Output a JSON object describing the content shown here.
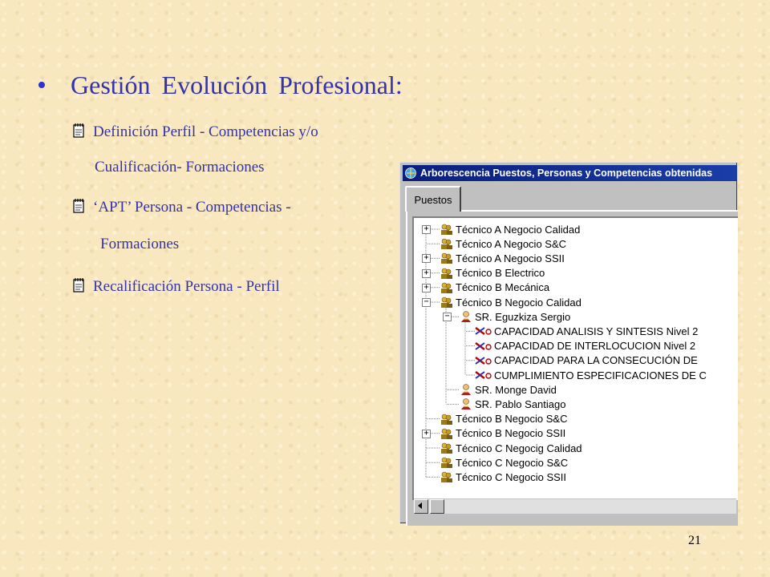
{
  "slide": {
    "title": "Gestión  Evolución  Profesional:",
    "bullet_glyph": "•",
    "sub_items": [
      {
        "line1": "Definición Perfil - Competencias y/o",
        "line2": "Cualificación- Formaciones"
      },
      {
        "line1": "‘APT’ Persona - Competencias -",
        "line2": "Formaciones"
      },
      {
        "line1": "Recalificación Persona - Perfil"
      }
    ],
    "page_number": "21"
  },
  "window": {
    "title": "Arborescencia Puestos, Personas y Competencias obtenidas",
    "tab_label": "Puestos",
    "tree": [
      {
        "label": "Técnico A Negocio Calidad",
        "level": 0,
        "expander": "+",
        "icon": "workers-icon"
      },
      {
        "label": "Técnico A Negocio S&C",
        "level": 0,
        "expander": "",
        "icon": "workers-icon"
      },
      {
        "label": "Técnico A Negocio SSII",
        "level": 0,
        "expander": "+",
        "icon": "workers-icon"
      },
      {
        "label": "Técnico B Electrico",
        "level": 0,
        "expander": "+",
        "icon": "workers-icon"
      },
      {
        "label": "Técnico B Mecánica",
        "level": 0,
        "expander": "+",
        "icon": "workers-icon"
      },
      {
        "label": "Técnico B Negocio Calidad",
        "level": 0,
        "expander": "−",
        "icon": "workers-icon"
      },
      {
        "label": "SR. Eguzkiza Sergio",
        "level": 1,
        "expander": "−",
        "icon": "person-icon"
      },
      {
        "label": "CAPACIDAD ANALISIS Y SINTESIS Nivel 2",
        "level": 2,
        "expander": "",
        "icon": "competency-icon"
      },
      {
        "label": "CAPACIDAD DE INTERLOCUCION Nivel 2",
        "level": 2,
        "expander": "",
        "icon": "competency-icon"
      },
      {
        "label": "CAPACIDAD PARA LA CONSECUCIÓN DE",
        "level": 2,
        "expander": "",
        "icon": "competency-icon"
      },
      {
        "label": "CUMPLIMIENTO ESPECIFICACIONES DE C",
        "level": 2,
        "expander": "",
        "icon": "competency-icon"
      },
      {
        "label": "SR. Monge David",
        "level": 1,
        "expander": "",
        "icon": "person-icon"
      },
      {
        "label": "SR. Pablo Santiago",
        "level": 1,
        "expander": "",
        "icon": "person-icon"
      },
      {
        "label": "Técnico B Negocio S&C",
        "level": 0,
        "expander": "",
        "icon": "workers-icon"
      },
      {
        "label": "Técnico B Negocio SSII",
        "level": 0,
        "expander": "+",
        "icon": "workers-icon"
      },
      {
        "label": "Técnico C Negocig Calidad",
        "level": 0,
        "expander": "",
        "icon": "workers-icon"
      },
      {
        "label": "Técnico C Negocio S&C",
        "level": 0,
        "expander": "",
        "icon": "workers-icon"
      },
      {
        "label": "Técnico C Negocio SSII",
        "level": 0,
        "expander": "",
        "icon": "workers-icon"
      }
    ]
  },
  "colors": {
    "text": "#3333aa",
    "background": "#f8e7bf",
    "titlebar": "#0a1f7a"
  }
}
